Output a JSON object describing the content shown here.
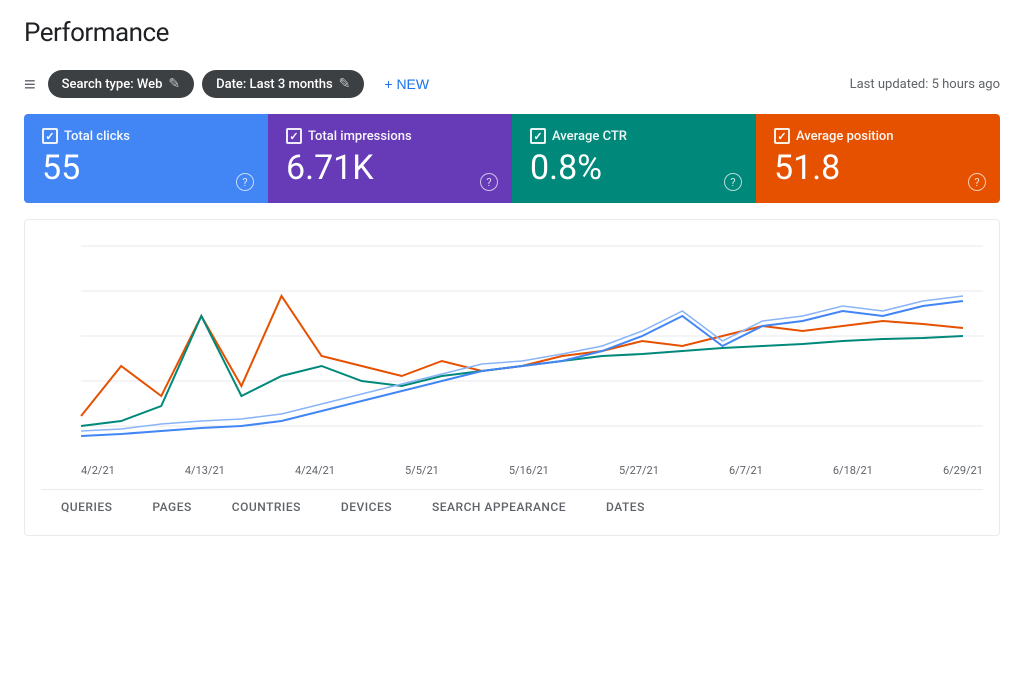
{
  "page": {
    "title": "Performance",
    "last_updated": "Last updated: 5 hours ago"
  },
  "toolbar": {
    "filter_icon": "≡",
    "chips": [
      {
        "label": "Search type: Web",
        "edit_icon": "✎"
      },
      {
        "label": "Date: Last 3 months",
        "edit_icon": "✎"
      }
    ],
    "new_button": "+ NEW"
  },
  "metrics": [
    {
      "id": "total-clicks",
      "label": "Total clicks",
      "value": "55",
      "color": "blue"
    },
    {
      "id": "total-impressions",
      "label": "Total impressions",
      "value": "6.71K",
      "color": "purple"
    },
    {
      "id": "average-ctr",
      "label": "Average CTR",
      "value": "0.8%",
      "color": "teal"
    },
    {
      "id": "average-position",
      "label": "Average position",
      "value": "51.8",
      "color": "orange"
    }
  ],
  "chart": {
    "x_labels": [
      "4/2/21",
      "4/13/21",
      "4/24/21",
      "5/5/21",
      "5/16/21",
      "5/27/21",
      "6/7/21",
      "6/18/21",
      "6/29/21"
    ]
  },
  "tabs": [
    {
      "label": "QUERIES",
      "active": false
    },
    {
      "label": "PAGES",
      "active": false
    },
    {
      "label": "COUNTRIES",
      "active": false
    },
    {
      "label": "DEVICES",
      "active": false
    },
    {
      "label": "SEARCH APPEARANCE",
      "active": false
    },
    {
      "label": "DATES",
      "active": false
    }
  ]
}
